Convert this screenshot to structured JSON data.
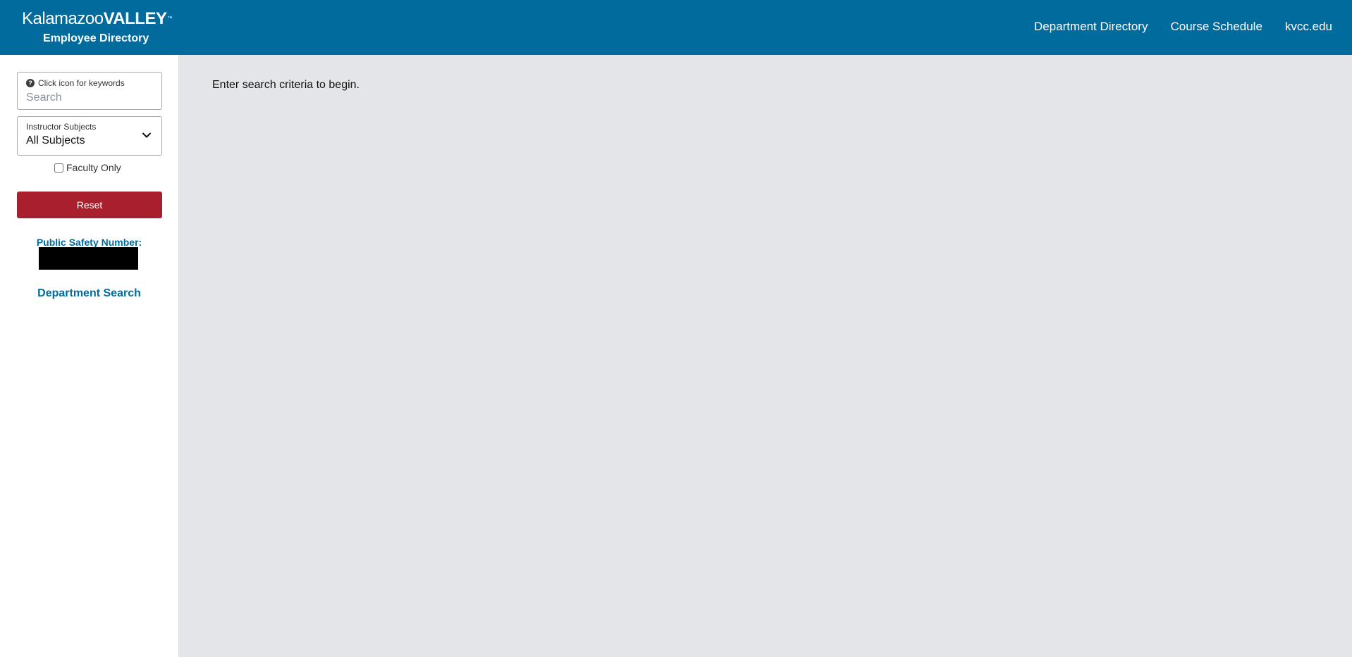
{
  "header": {
    "logo_light": "Kalamazoo",
    "logo_bold": "VALLEY",
    "logo_tm": "™",
    "subtitle": "Employee Directory",
    "nav": [
      {
        "label": "Department Directory"
      },
      {
        "label": "Course Schedule"
      },
      {
        "label": "kvcc.edu"
      }
    ]
  },
  "sidebar": {
    "search": {
      "hint": "Click icon for keywords",
      "help_icon_glyph": "?",
      "placeholder": "Search",
      "value": ""
    },
    "subjects": {
      "label": "Instructor Subjects",
      "value": "All Subjects"
    },
    "faculty_only": {
      "label": "Faculty Only",
      "checked": false
    },
    "reset_label": "Reset",
    "public_safety_label": "Public Safety Number:",
    "department_search_label": "Department Search"
  },
  "main": {
    "message": "Enter search criteria to begin."
  },
  "colors": {
    "header_bg": "#006b9c",
    "accent_blue": "#006b9c",
    "reset_red": "#a81f2d",
    "main_bg": "#e4e5e9"
  },
  "icons": {
    "help": "question-circle-icon",
    "dropdown": "chevron-down-icon"
  }
}
